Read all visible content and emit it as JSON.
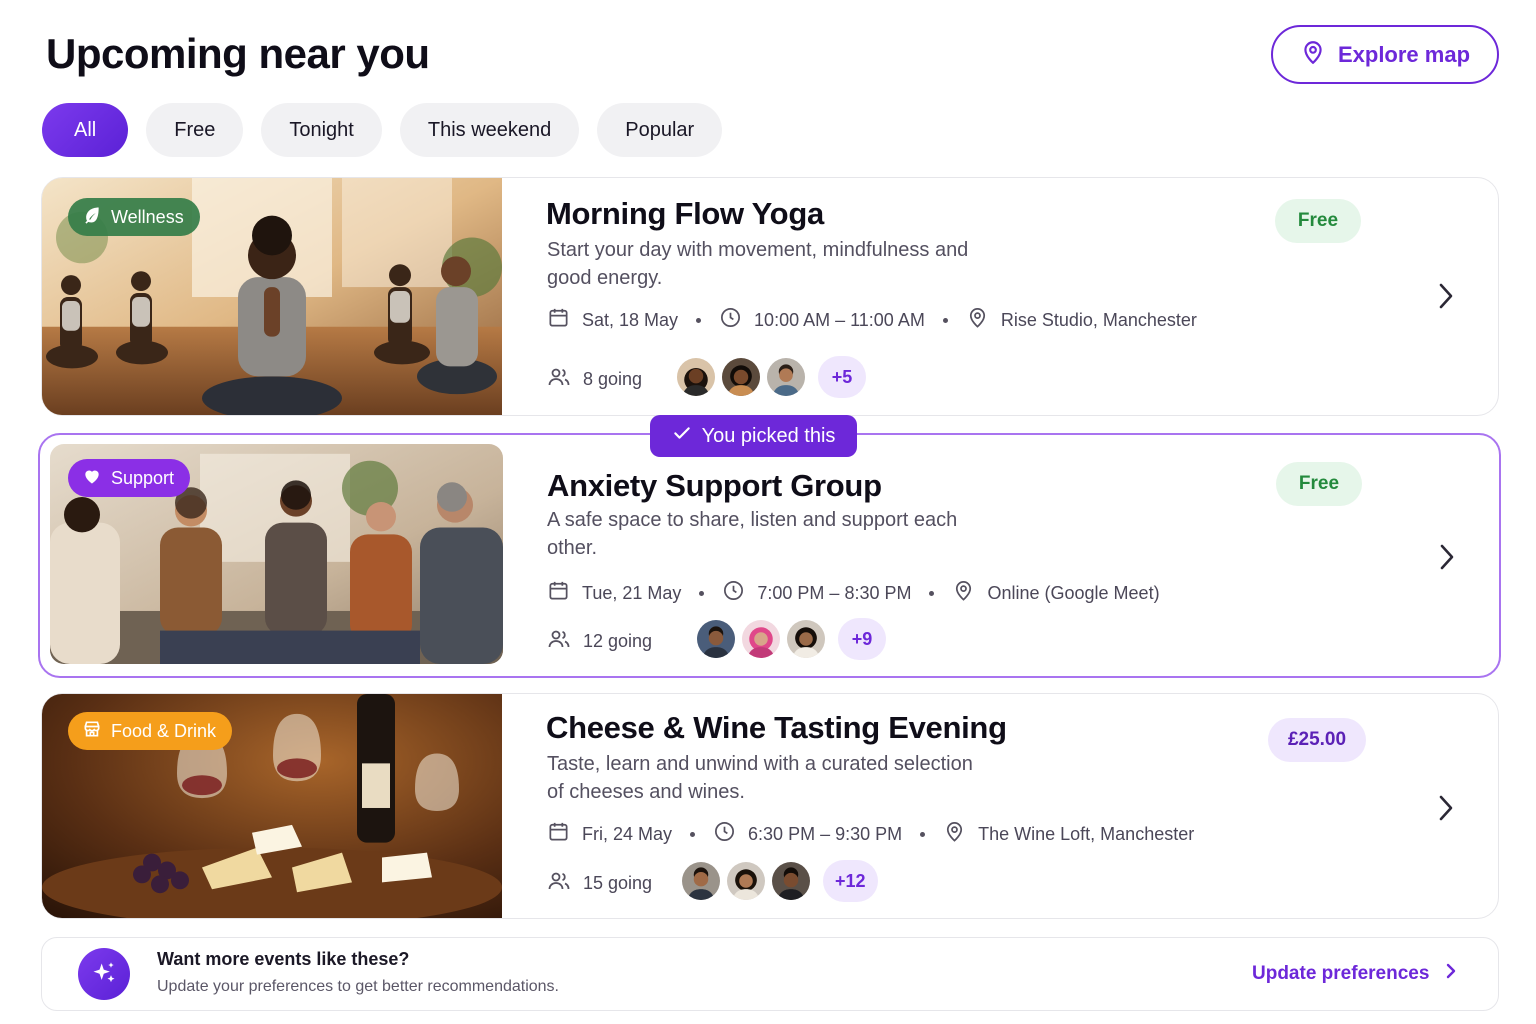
{
  "header": {
    "title": "Upcoming near you",
    "explore_label": "Explore map"
  },
  "filters": [
    {
      "label": "All",
      "active": true
    },
    {
      "label": "Free",
      "active": false
    },
    {
      "label": "Tonight",
      "active": false
    },
    {
      "label": "This weekend",
      "active": false
    },
    {
      "label": "Popular",
      "active": false
    }
  ],
  "events": [
    {
      "tag": "Wellness",
      "title": "Morning Flow Yoga",
      "description": "Start your day with movement, mindfulness and good energy.",
      "date": "Sat, 18 May",
      "time": "10:00 AM – 11:00 AM",
      "location": "Rise Studio, Manchester",
      "going": "8 going",
      "more": "+5",
      "price": "Free",
      "picked": false
    },
    {
      "tag": "Support",
      "title": "Anxiety Support Group",
      "description": "A safe space to share, listen and support each other.",
      "date": "Tue, 21 May",
      "time": "7:00 PM – 8:30 PM",
      "location": "Online (Google Meet)",
      "going": "12 going",
      "more": "+9",
      "price": "Free",
      "picked": true,
      "picked_label": "You picked this"
    },
    {
      "tag": "Food & Drink",
      "title": "Cheese & Wine Tasting Evening",
      "description": "Taste, learn and unwind with a curated selection of cheeses and wines.",
      "date": "Fri, 24 May",
      "time": "6:30 PM – 9:30 PM",
      "location": "The Wine Loft, Manchester",
      "going": "15 going",
      "more": "+12",
      "price": "£25.00",
      "picked": false
    }
  ],
  "preferences": {
    "title": "Want more events like these?",
    "subtitle": "Update your preferences to get better recommendations.",
    "link": "Update preferences"
  },
  "colors": {
    "accent": "#6d28d9",
    "free_badge_bg": "#e6f6ea",
    "free_badge_text": "#248a3d",
    "wellness_tag": "#347d48",
    "support_tag": "#8b2fe6",
    "food_tag": "#f59e1b"
  },
  "icons": {
    "explore": "map-pin-icon",
    "date": "calendar-icon",
    "time": "clock-icon",
    "location": "map-pin-icon",
    "going": "users-icon",
    "picked": "check-icon",
    "preferences": "sparkles-icon",
    "chevron": "chevron-right-icon"
  }
}
